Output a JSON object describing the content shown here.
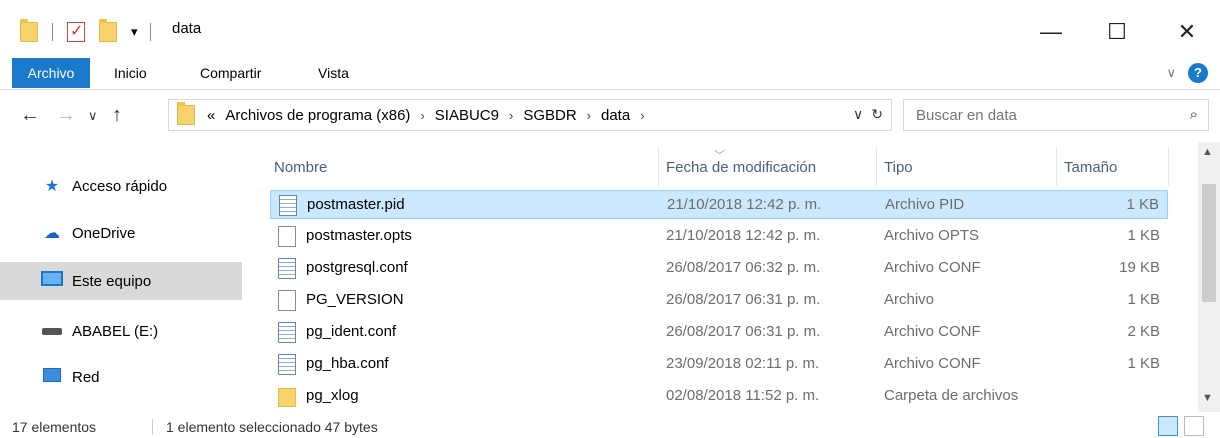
{
  "window": {
    "title": "data",
    "minimize": "—",
    "maximize": "☐",
    "close": "✕"
  },
  "ribbon": {
    "tabs": [
      "Archivo",
      "Inicio",
      "Compartir",
      "Vista"
    ],
    "expand": "∨",
    "help": "?"
  },
  "nav": {
    "back": "←",
    "forward": "→",
    "recent": "∨",
    "up": "↑"
  },
  "address": {
    "overflow": "«",
    "crumbs": [
      "Archivos de programa (x86)",
      "SIABUC9",
      "SGBDR",
      "data"
    ],
    "sep": "›",
    "dropdown": "∨",
    "refresh": "↻"
  },
  "search": {
    "placeholder": "Buscar en data",
    "icon": "⌕"
  },
  "sidebar": {
    "items": [
      {
        "label": "Acceso rápido",
        "icon": "star-icon"
      },
      {
        "label": "OneDrive",
        "icon": "cloud-icon"
      },
      {
        "label": "Este equipo",
        "icon": "computer-icon"
      },
      {
        "label": "ABABEL (E:)",
        "icon": "drive-icon"
      },
      {
        "label": "Red",
        "icon": "network-icon"
      }
    ]
  },
  "columns": {
    "name": "Nombre",
    "date": "Fecha de modificación",
    "type": "Tipo",
    "size": "Tamaño"
  },
  "files": [
    {
      "name": "postmaster.pid",
      "date": "21/10/2018 12:42 p. m.",
      "type": "Archivo PID",
      "size": "1 KB",
      "icon": "text-file-icon"
    },
    {
      "name": "postmaster.opts",
      "date": "21/10/2018 12:42 p. m.",
      "type": "Archivo OPTS",
      "size": "1 KB",
      "icon": "blank-file-icon"
    },
    {
      "name": "postgresql.conf",
      "date": "26/08/2017 06:32 p. m.",
      "type": "Archivo CONF",
      "size": "19 KB",
      "icon": "text-file-icon"
    },
    {
      "name": "PG_VERSION",
      "date": "26/08/2017 06:31 p. m.",
      "type": "Archivo",
      "size": "1 KB",
      "icon": "blank-file-icon"
    },
    {
      "name": "pg_ident.conf",
      "date": "26/08/2017 06:31 p. m.",
      "type": "Archivo CONF",
      "size": "2 KB",
      "icon": "text-file-icon"
    },
    {
      "name": "pg_hba.conf",
      "date": "23/09/2018 02:11 p. m.",
      "type": "Archivo CONF",
      "size": "1 KB",
      "icon": "text-file-icon"
    },
    {
      "name": "pg_xlog",
      "date": "02/08/2018 11:52 p. m.",
      "type": "Carpeta de archivos",
      "size": "",
      "icon": "folder-icon"
    }
  ],
  "status": {
    "count": "17 elementos",
    "selection": "1 elemento seleccionado  47 bytes"
  },
  "colors": {
    "accent": "#1979ca",
    "selection": "#cce8ff"
  }
}
